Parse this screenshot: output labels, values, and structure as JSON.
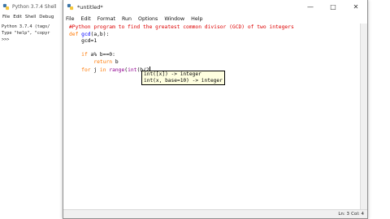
{
  "shell": {
    "title": "Python 3.7.4 Shell",
    "menu": [
      "File",
      "Edit",
      "Shell",
      "Debug"
    ],
    "lines": [
      "Python 3.7.4 (tags/",
      "Type \"help\", \"copyr",
      ">>> "
    ]
  },
  "editor": {
    "title": "*untitled*",
    "menu": [
      "File",
      "Edit",
      "Format",
      "Run",
      "Options",
      "Window",
      "Help"
    ],
    "window_controls": [
      "minimize",
      "maximize",
      "close"
    ],
    "code": {
      "l1": "#Python program to find the greatest common divisor (GCD) of two integers",
      "l2_kw": "def",
      "l2_name": "gcd",
      "l2_rest": "(a,b):",
      "l3": "    gcd=1",
      "l5_kw": "if",
      "l5_rest": " a% b==0:",
      "l6_kw": "return",
      "l6_rest": " b",
      "l7_kw1": "for",
      "l7_mid1": " j ",
      "l7_kw2": "in",
      "l7_mid2": " ",
      "l7_bi1": "range",
      "l7_mid3": "(",
      "l7_bi2": "int",
      "l7_end": "(b/2"
    },
    "calltip": [
      "int([x]) -> integer",
      "int(x, base=10) -> integer"
    ],
    "status": {
      "line": "Ln: 3",
      "col": "Col: 4"
    }
  }
}
